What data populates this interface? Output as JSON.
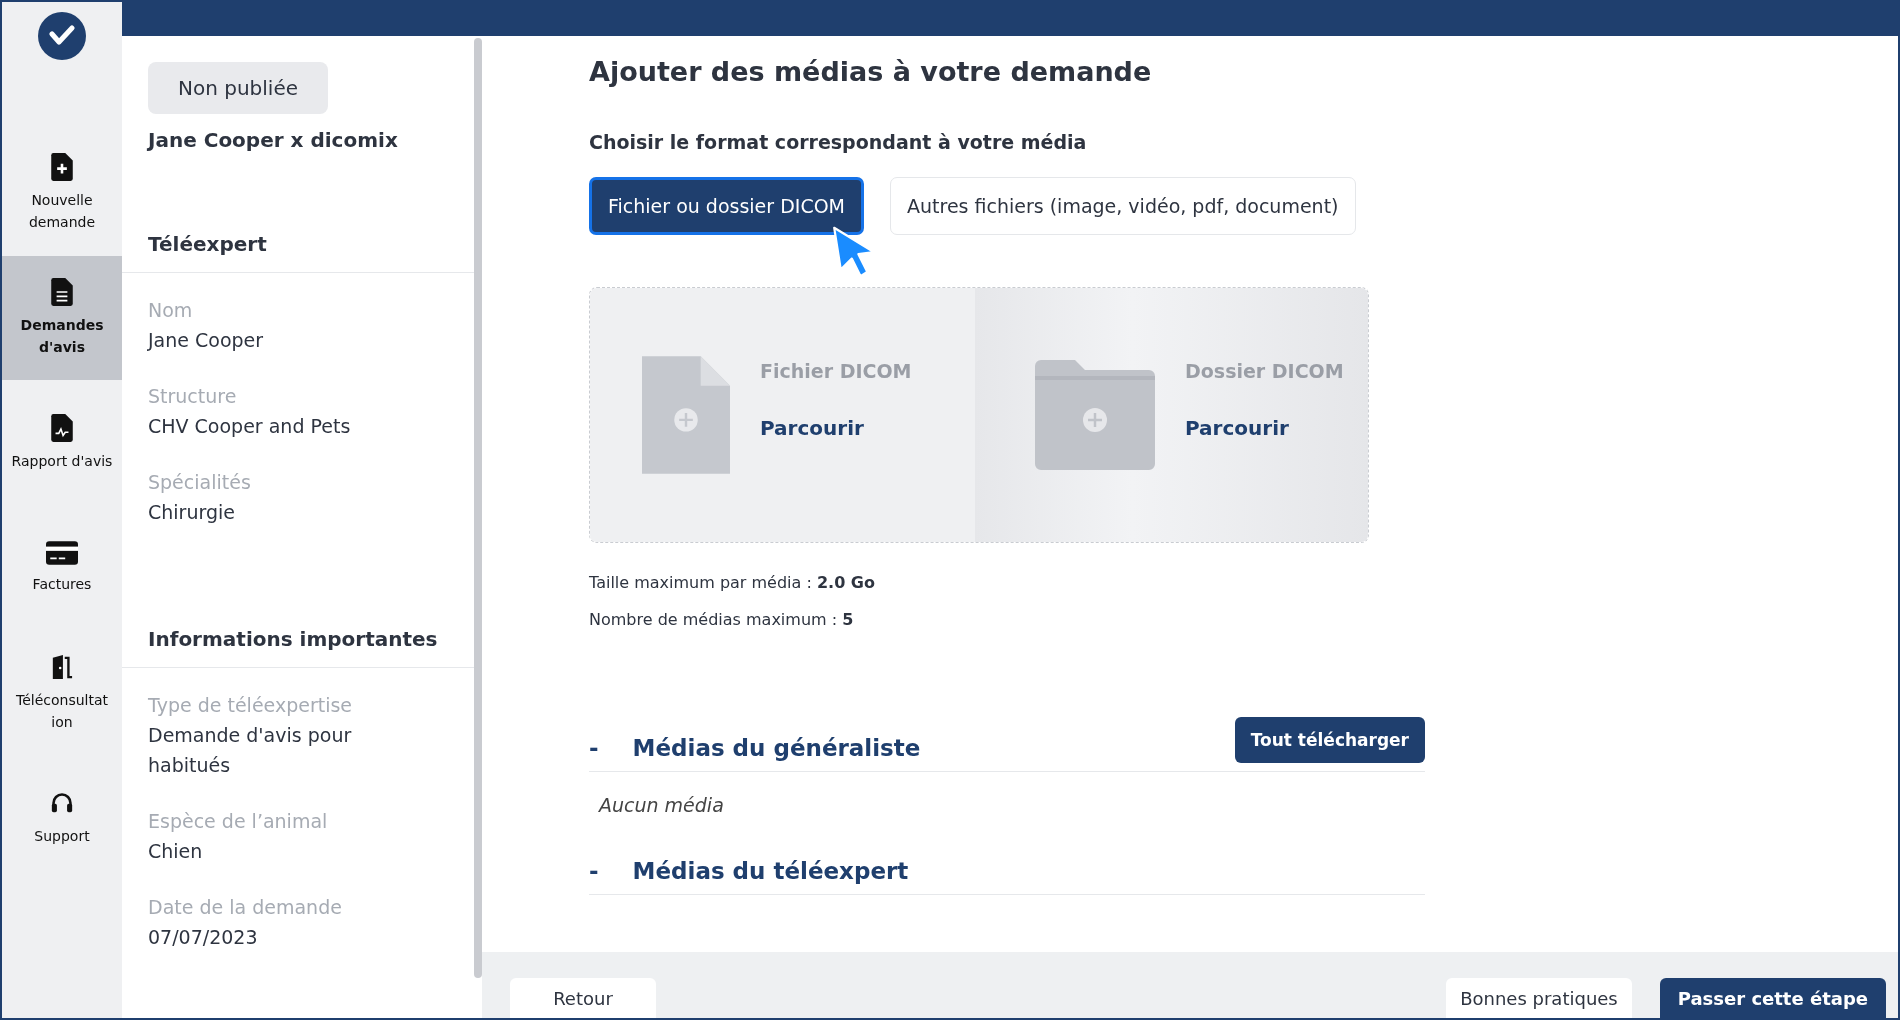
{
  "nav": {
    "items": [
      {
        "kind": "file-plus",
        "label": "Nouvelle demande",
        "selected": false
      },
      {
        "kind": "file-lines",
        "label": "Demandes d'avis",
        "selected": true
      },
      {
        "kind": "file-chart",
        "label": "Rapport d'avis",
        "selected": false
      },
      {
        "kind": "card",
        "label": "Factures",
        "selected": false
      },
      {
        "kind": "door",
        "label": "Téléconsultat ion",
        "selected": false
      },
      {
        "kind": "headset",
        "label": "Support",
        "selected": false
      }
    ]
  },
  "sidebar": {
    "status": "Non publiée",
    "title": "Jane Cooper x dicomix",
    "sections": [
      {
        "heading": "Téléexpert",
        "fields": [
          {
            "label": "Nom",
            "value": "Jane Cooper"
          },
          {
            "label": "Structure",
            "value": "CHV Cooper and Pets"
          },
          {
            "label": "Spécialités",
            "value": "Chirurgie"
          }
        ]
      },
      {
        "heading": "Informations importantes",
        "fields": [
          {
            "label": "Type de téléexpertise",
            "value": "Demande d'avis pour habitués"
          },
          {
            "label": "Espèce de l’animal",
            "value": "Chien"
          },
          {
            "label": "Date de la demande",
            "value": "07/07/2023"
          }
        ]
      }
    ]
  },
  "main": {
    "title": "Ajouter des médias à votre demande",
    "subtitle": "Choisir le format correspondant à votre média",
    "format_tabs": [
      {
        "label": "Fichier ou dossier DICOM",
        "selected": true
      },
      {
        "label": "Autres fichiers (image, vidéo, pdf, document)",
        "selected": false
      }
    ],
    "dropzones": [
      {
        "kind": "file",
        "title": "Fichier DICOM",
        "action": "Parcourir"
      },
      {
        "kind": "folder",
        "title": "Dossier DICOM",
        "action": "Parcourir"
      }
    ],
    "limits": [
      "Taille maximum par média : **2.0 Go**",
      "Nombre de médias maximum : **5**"
    ],
    "download_button": "Tout télécharger",
    "media_sections": [
      {
        "toggle": "-",
        "title": "Médias du généraliste",
        "empty_text": "Aucun média"
      },
      {
        "toggle": "-",
        "title": "Médias du téléexpert"
      }
    ]
  },
  "footer": {
    "left_buttons": [
      {
        "kind": "secondary",
        "label": "Retour"
      }
    ],
    "right_buttons": [
      {
        "kind": "secondary",
        "label": "Bonnes pratiques"
      },
      {
        "kind": "primary",
        "label": "Passer cette étape"
      }
    ]
  }
}
